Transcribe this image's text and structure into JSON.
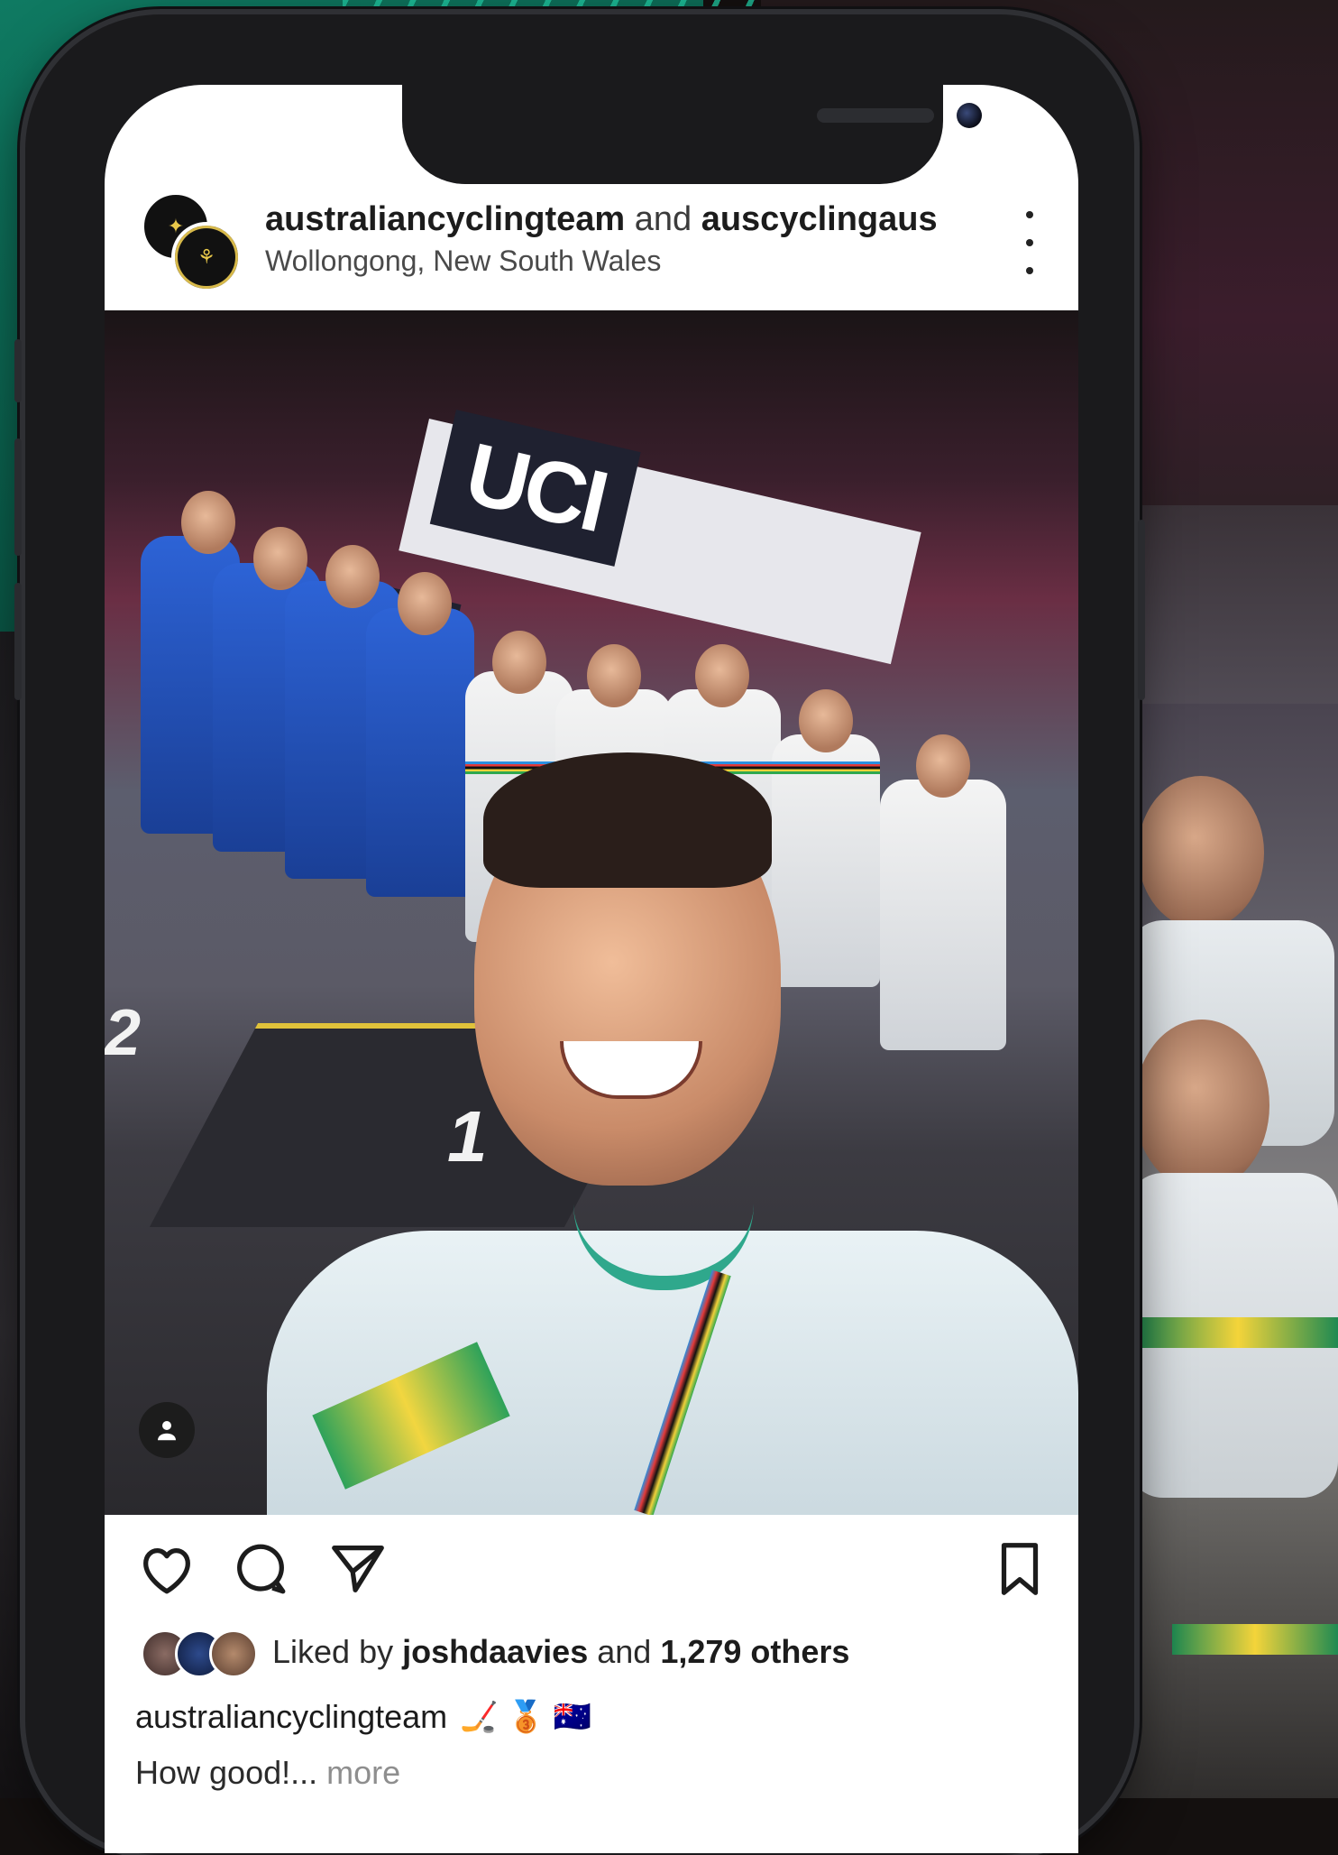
{
  "post": {
    "author": "australiancyclingteam",
    "connector": "and",
    "collaborator": "auscyclingaus",
    "location": "Wollongong, New South Wales"
  },
  "image": {
    "banner_text": "UCI",
    "podium_first": "1",
    "podium_second": "2"
  },
  "engagement": {
    "liked_by_prefix": "Liked by",
    "liked_by_user": "joshdaavies",
    "connector": "and",
    "others_count": "1,279 others"
  },
  "caption": {
    "author": "australiancyclingteam",
    "emojis": "🏒 🥉 🇦🇺",
    "text": "How good!...",
    "more_label": "more"
  },
  "icons": {
    "like": "heart-icon",
    "comment": "comment-icon",
    "share": "send-icon",
    "save": "bookmark-icon",
    "options": "more-options-icon",
    "audio": "audio-icon"
  },
  "colors": {
    "brand_green": "#0f7a62",
    "text_primary": "#1c1c1c",
    "text_muted": "#8e8e8e"
  }
}
